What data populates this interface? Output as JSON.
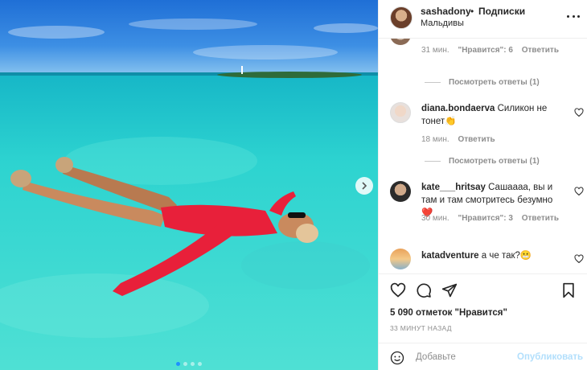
{
  "post": {
    "username": "sashadony",
    "separator": "•",
    "follow_label": "Подписки",
    "location": "Мальдивы",
    "more_icon": "more-horizontal-icon"
  },
  "photo": {
    "carousel_count": 4,
    "active_index": 0,
    "next_icon": "chevron-right-icon"
  },
  "comments": [
    {
      "meta": {
        "time": "31 мин.",
        "likes": "\"Нравится\": 6",
        "reply": "Ответить"
      },
      "view_replies": "Посмотреть ответы (1)"
    },
    {
      "username": "diana.bondaerva",
      "text": "Силикон не тонет👏",
      "meta": {
        "time": "18 мин.",
        "reply": "Ответить"
      },
      "view_replies": "Посмотреть ответы (1)"
    },
    {
      "username": "kate___hritsay",
      "text": "Сашаааа, вы и там и там смотритесь безумно ❤️",
      "meta": {
        "time": "30 мин.",
        "likes": "\"Нравится\": 3",
        "reply": "Ответить"
      }
    },
    {
      "username": "katadventure",
      "text": "а че так?😬"
    }
  ],
  "actions": {
    "like_icon": "heart-icon",
    "comment_icon": "comment-icon",
    "share_icon": "share-icon",
    "save_icon": "bookmark-icon",
    "likes_text": "5 090 отметок \"Нравится\"",
    "posted_time": "33 МИНУТ НАЗАД"
  },
  "add_comment": {
    "emoji_icon": "smile-icon",
    "placeholder": "Добавьте",
    "publish_label": "Опубликовать"
  },
  "colors": {
    "link_blue": "#b2dffc",
    "muted": "#8e8e8e",
    "carousel_active": "#1e90ff"
  }
}
